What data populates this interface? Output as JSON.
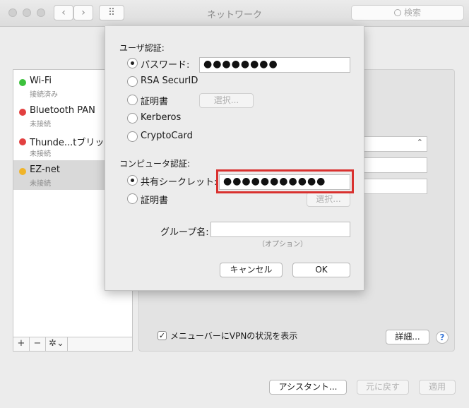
{
  "window": {
    "title": "ネットワーク",
    "nav_back": "‹",
    "nav_forward": "›",
    "grid_icon": "⠿",
    "search_placeholder": "検索"
  },
  "services": [
    {
      "name": "Wi-Fi",
      "status": "接続済み",
      "color": "#3cc13c"
    },
    {
      "name": "Bluetooth PAN",
      "status": "未接続",
      "color": "#e24040"
    },
    {
      "name": "Thunde...tブリッジ",
      "status": "未接続",
      "color": "#e24040"
    },
    {
      "name": "EZ-net",
      "status": "未接続",
      "color": "#f0b429"
    }
  ],
  "list_bar": {
    "add": "+",
    "remove": "−",
    "gear": "✲⌄"
  },
  "sheet": {
    "user_auth_title": "ユーザ認証:",
    "user_auth_options": [
      "パスワード:",
      "RSA SecurID",
      "証明書",
      "Kerberos",
      "CryptoCard"
    ],
    "password_value": "●●●●●●●●",
    "select_label": "選択...",
    "machine_auth_title": "コンピュータ認証:",
    "machine_auth_options": [
      "共有シークレット:",
      "証明書"
    ],
    "shared_secret_value": "●●●●●●●●●●●",
    "group_label": "グループ名:",
    "group_value": "",
    "optional_note": "（オプション）",
    "cancel": "キャンセル",
    "ok": "OK"
  },
  "panel": {
    "show_vpn_label": "メニューバーにVPNの状況を表示",
    "show_vpn_checked": "✓",
    "details": "詳細...",
    "help": "?"
  },
  "footer": {
    "assistant": "アシスタント...",
    "revert": "元に戻す",
    "apply": "適用"
  }
}
